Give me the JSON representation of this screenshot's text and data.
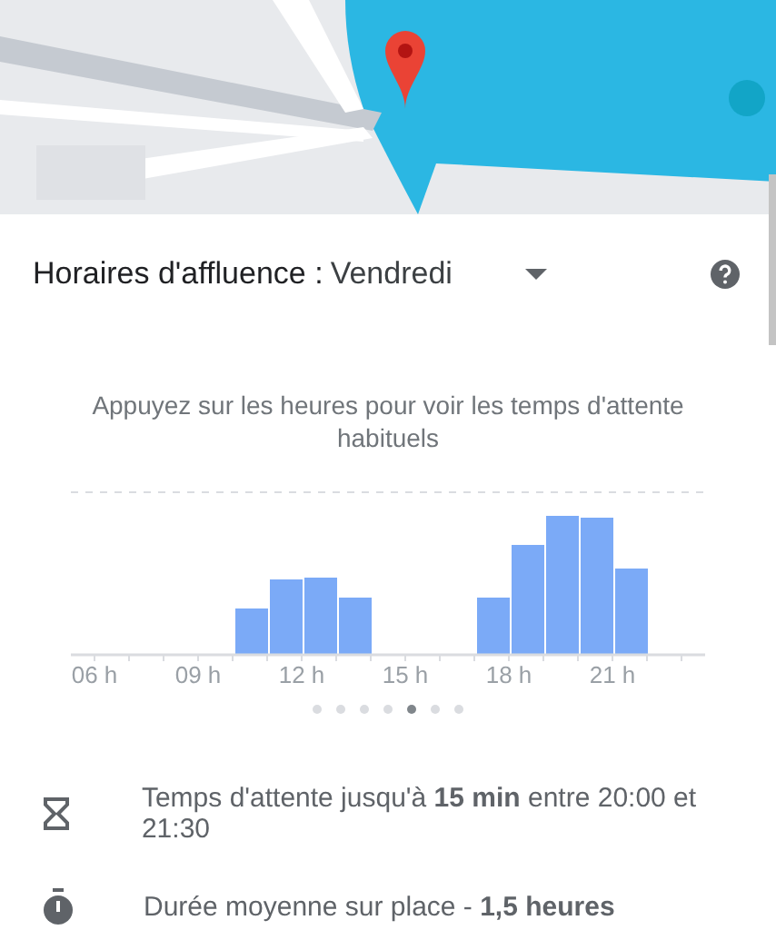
{
  "popular_times": {
    "title": "Horaires d'affluence :",
    "day": "Vendredi",
    "hint": "Appuyez sur les heures pour voir les temps d'attente habituels",
    "hour_labels": [
      "06 h",
      "09 h",
      "12 h",
      "15 h",
      "18 h",
      "21 h"
    ],
    "pages": [
      {
        "selected": false
      },
      {
        "selected": false
      },
      {
        "selected": false
      },
      {
        "selected": false
      },
      {
        "selected": true
      },
      {
        "selected": false
      },
      {
        "selected": false
      }
    ]
  },
  "info": [
    {
      "kind": "wait",
      "text": "Temps d'attente jusqu'à **15 min** entre 20:00 et 21:30"
    },
    {
      "kind": "duration",
      "text": "Durée moyenne sur place - **1,5 heures**"
    }
  ]
}
